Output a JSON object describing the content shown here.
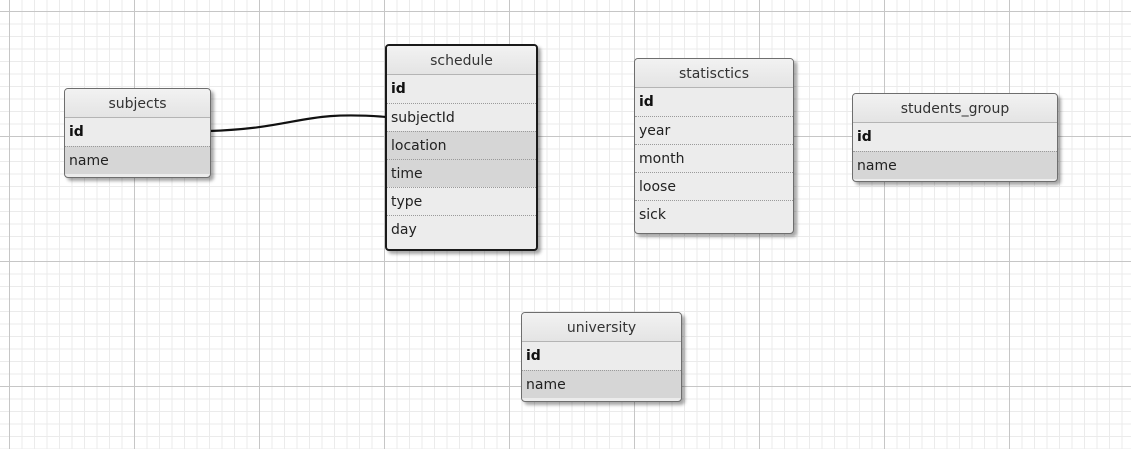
{
  "tables": {
    "subjects": {
      "name": "subjects",
      "fields": [
        "id",
        "name"
      ]
    },
    "schedule": {
      "name": "schedule",
      "fields": [
        "id",
        "subjectId",
        "location",
        "time",
        "type",
        "day"
      ]
    },
    "statisctics": {
      "name": "statisctics",
      "fields": [
        "id",
        "year",
        "month",
        "loose",
        "sick"
      ]
    },
    "students_group": {
      "name": "students_group",
      "fields": [
        "id",
        "name"
      ]
    },
    "university": {
      "name": "university",
      "fields": [
        "id",
        "name"
      ]
    }
  },
  "relations": [
    {
      "from": "subjects.id",
      "to": "schedule.subjectId"
    }
  ],
  "colors": {
    "header": "#e8e8e8",
    "row": "#ececec",
    "row_alt": "#d6d6d6",
    "border": "#6e6e6e",
    "selected_border": "#1a1a1a",
    "relation_line": "#111111"
  }
}
